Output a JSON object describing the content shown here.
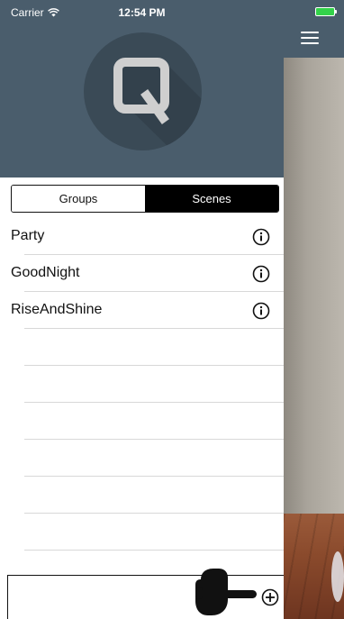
{
  "status_bar": {
    "carrier": "Carrier",
    "time": "12:54 PM",
    "wifi_icon": "wifi-icon",
    "battery_icon": "battery-icon",
    "battery_color": "#33d24a"
  },
  "header": {
    "logo_letter": "Q",
    "background_color": "#4a5d6c",
    "menu_icon": "hamburger-menu-icon"
  },
  "segmented": {
    "options": [
      {
        "label": "Groups",
        "selected": false
      },
      {
        "label": "Scenes",
        "selected": true
      }
    ]
  },
  "scenes": {
    "items": [
      {
        "label": "Party",
        "icon": "info-icon"
      },
      {
        "label": "GoodNight",
        "icon": "info-icon"
      },
      {
        "label": "RiseAndShine",
        "icon": "info-icon"
      },
      {
        "label": "",
        "icon": ""
      },
      {
        "label": "",
        "icon": ""
      },
      {
        "label": "",
        "icon": ""
      },
      {
        "label": "",
        "icon": ""
      },
      {
        "label": "",
        "icon": ""
      },
      {
        "label": "",
        "icon": ""
      }
    ]
  },
  "add_bar": {
    "pointer_icon": "pointing-hand-icon",
    "add_icon": "add-circle-icon"
  }
}
